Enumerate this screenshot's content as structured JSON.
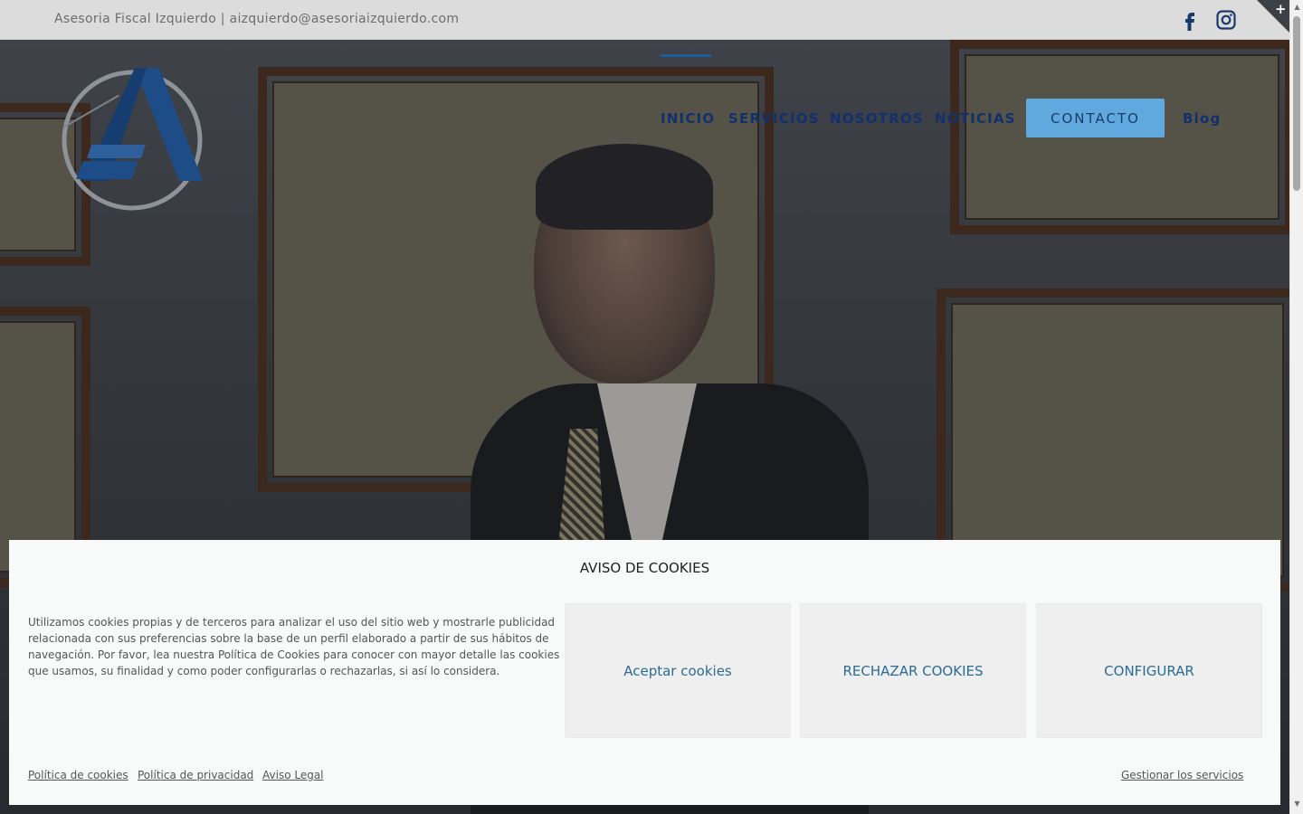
{
  "topbar": {
    "text": "Asesoria Fiscal Izquierdo | aizquierdo@asesoriaizquierdo.com",
    "social": [
      "facebook-icon",
      "instagram-icon"
    ]
  },
  "corner": {
    "symbol": "+"
  },
  "nav": {
    "items": [
      "INICIO",
      "SERVICIOS",
      "NOSOTROS",
      "NOTICIAS"
    ],
    "contact": "CONTACTO",
    "blog": "Blog"
  },
  "cookies": {
    "title": "AVISO DE COOKIES",
    "text": "Utilizamos cookies propias y de terceros para analizar el uso del sitio web y mostrarle publicidad relacionada con sus preferencias sobre la base de un perfil elaborado a partir de sus hábitos de navegación. Por favor, lea nuestra Política de Cookies para conocer con mayor detalle las cookies que usamos, su finalidad y como poder configurarlas o rechazarlas, si así lo considera.",
    "accept": "Aceptar cookies",
    "reject": "RECHAZAR COOKIES",
    "configure": "CONFIGURAR",
    "links": [
      "Política de cookies",
      "Política de privacidad",
      "Aviso Legal"
    ],
    "manage": "Gestionar los servicios"
  },
  "colors": {
    "nav": "#11306e",
    "accent": "#1c5d9a",
    "contact_button": "#5fa9de",
    "cookie_link": "#2b6c95"
  }
}
